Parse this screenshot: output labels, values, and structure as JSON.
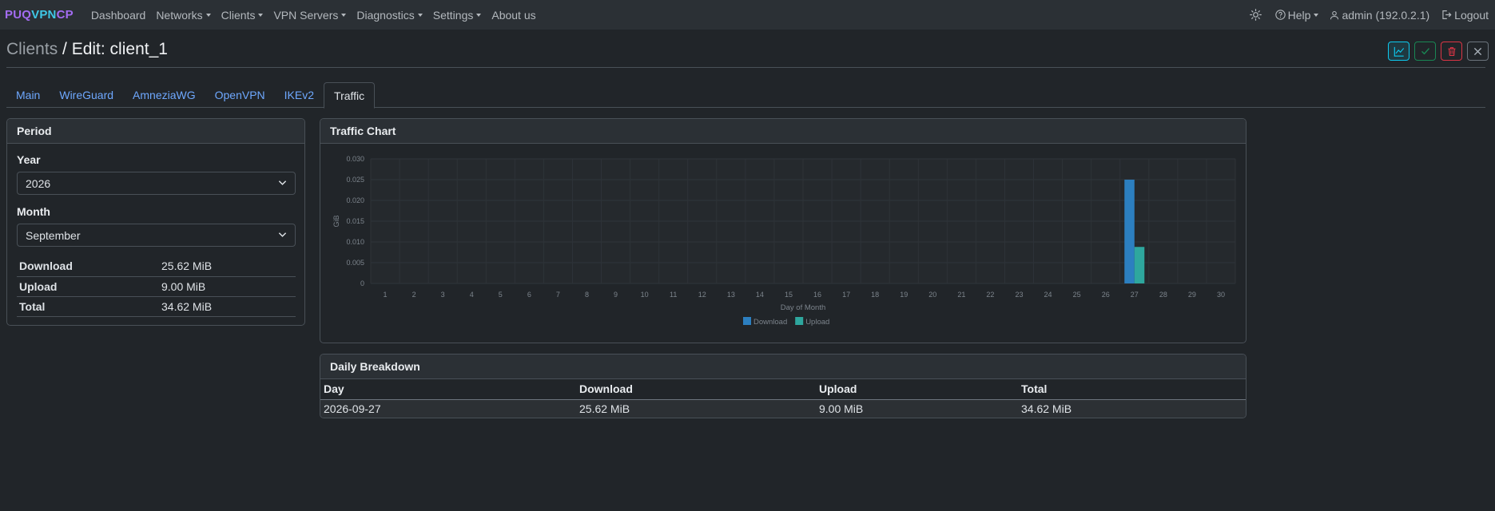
{
  "brand": {
    "part1": "PUQ",
    "part2": "VPN",
    "part3": "CP"
  },
  "nav": {
    "dashboard": "Dashboard",
    "networks": "Networks",
    "clients": "Clients",
    "vpn_servers": "VPN Servers",
    "diagnostics": "Diagnostics",
    "settings": "Settings",
    "about": "About us",
    "help": "Help",
    "user": "admin (192.0.2.1)",
    "logout": "Logout"
  },
  "header": {
    "crumb": "Clients",
    "title": " / Edit: client_1"
  },
  "tabs": [
    "Main",
    "WireGuard",
    "AmneziaWG",
    "OpenVPN",
    "IKEv2",
    "Traffic"
  ],
  "period": {
    "title": "Period",
    "year_label": "Year",
    "year_value": "2026",
    "month_label": "Month",
    "month_value": "September",
    "stats": [
      {
        "label": "Download",
        "value": "25.62 MiB"
      },
      {
        "label": "Upload",
        "value": "9.00 MiB"
      },
      {
        "label": "Total",
        "value": "34.62 MiB"
      }
    ]
  },
  "chart_title": "Traffic Chart",
  "chart_data": {
    "type": "bar",
    "title": "",
    "xlabel": "Day of Month",
    "ylabel": "GiB",
    "ylim": [
      0,
      0.03
    ],
    "yticks": [
      "0",
      "0.005",
      "0.010",
      "0.015",
      "0.020",
      "0.025",
      "0.030"
    ],
    "categories": [
      "1",
      "2",
      "3",
      "4",
      "5",
      "6",
      "7",
      "8",
      "9",
      "10",
      "11",
      "12",
      "13",
      "14",
      "15",
      "16",
      "17",
      "18",
      "19",
      "20",
      "21",
      "22",
      "23",
      "24",
      "25",
      "26",
      "27",
      "28",
      "29",
      "30"
    ],
    "series": [
      {
        "name": "Download",
        "color": "#2c7fc0",
        "values": [
          0,
          0,
          0,
          0,
          0,
          0,
          0,
          0,
          0,
          0,
          0,
          0,
          0,
          0,
          0,
          0,
          0,
          0,
          0,
          0,
          0,
          0,
          0,
          0,
          0,
          0,
          0.025,
          0,
          0,
          0
        ]
      },
      {
        "name": "Upload",
        "color": "#2ea79e",
        "values": [
          0,
          0,
          0,
          0,
          0,
          0,
          0,
          0,
          0,
          0,
          0,
          0,
          0,
          0,
          0,
          0,
          0,
          0,
          0,
          0,
          0,
          0,
          0,
          0,
          0,
          0,
          0.0088,
          0,
          0,
          0
        ]
      }
    ],
    "grid": true,
    "legend": "bottom-center"
  },
  "daily": {
    "title": "Daily Breakdown",
    "columns": [
      "Day",
      "Download",
      "Upload",
      "Total"
    ],
    "rows": [
      [
        "2026-09-27",
        "25.62 MiB",
        "9.00 MiB",
        "34.62 MiB"
      ]
    ]
  }
}
